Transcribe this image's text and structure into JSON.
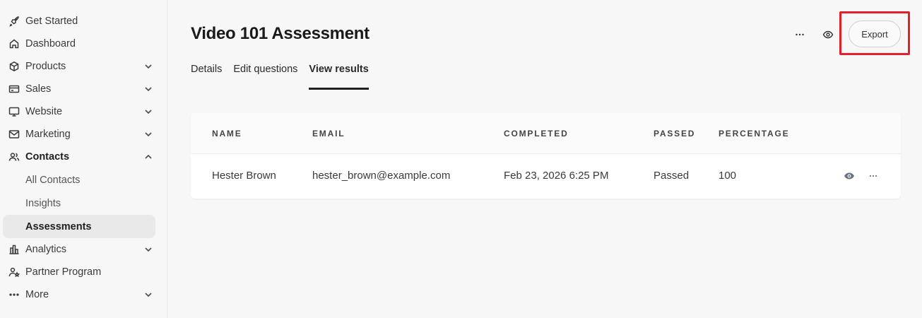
{
  "sidebar": {
    "items": [
      {
        "label": "Get Started",
        "icon": "rocket-icon"
      },
      {
        "label": "Dashboard",
        "icon": "home-icon"
      },
      {
        "label": "Products",
        "icon": "box-icon"
      },
      {
        "label": "Sales",
        "icon": "credit-card-icon"
      },
      {
        "label": "Website",
        "icon": "monitor-icon"
      },
      {
        "label": "Marketing",
        "icon": "mail-icon"
      },
      {
        "label": "Contacts",
        "icon": "users-icon"
      },
      {
        "label": "Analytics",
        "icon": "bar-chart-icon"
      },
      {
        "label": "Partner Program",
        "icon": "partner-icon"
      },
      {
        "label": "More",
        "icon": "more-horizontal-icon"
      }
    ],
    "contacts_sub": [
      {
        "label": "All Contacts"
      },
      {
        "label": "Insights"
      },
      {
        "label": "Assessments"
      }
    ]
  },
  "header": {
    "title": "Video 101 Assessment",
    "export_label": "Export"
  },
  "tabs": [
    {
      "label": "Details"
    },
    {
      "label": "Edit questions"
    },
    {
      "label": "View results"
    }
  ],
  "table": {
    "headers": [
      "NAME",
      "EMAIL",
      "COMPLETED",
      "PASSED",
      "PERCENTAGE"
    ],
    "rows": [
      [
        "Hester Brown",
        "hester_brown@example.com",
        "Feb 23, 2026 6:25 PM",
        "Passed",
        "100"
      ]
    ]
  },
  "colors": {
    "highlight": "#e0202a",
    "accent": "#1f1f1f"
  }
}
